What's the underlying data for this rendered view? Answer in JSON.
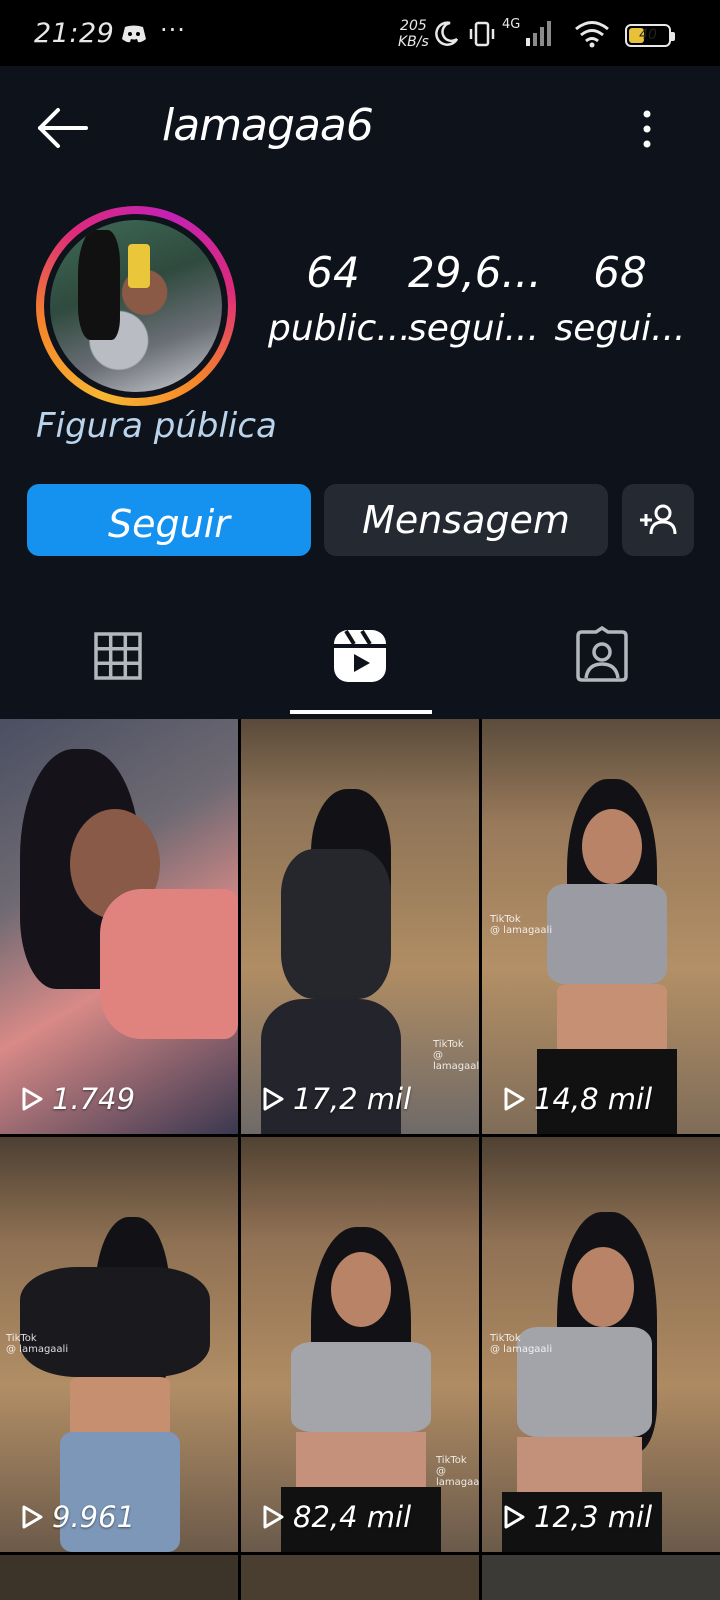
{
  "status_bar": {
    "time": "21:29",
    "overflow": "···",
    "net_speed_value": "205",
    "net_speed_unit": "KB/s",
    "network": "4G",
    "battery": "40",
    "icons": [
      "discord-icon",
      "moon-icon",
      "vibrate-icon",
      "signal-icon",
      "wifi-icon",
      "battery-icon"
    ]
  },
  "header": {
    "username": "lamagaa6",
    "back_icon": "arrow-left-icon",
    "menu_icon": "more-vertical-icon"
  },
  "profile": {
    "stats": [
      {
        "value": "64",
        "label": "public..."
      },
      {
        "value": "29,6...",
        "label": "segui..."
      },
      {
        "value": "68",
        "label": "segui..."
      }
    ],
    "category": "Figura pública"
  },
  "actions": {
    "follow": "Seguir",
    "message": "Mensagem",
    "add_user_icon": "person-add-icon"
  },
  "tabs": [
    {
      "icon": "grid-icon",
      "active": false
    },
    {
      "icon": "reels-icon",
      "active": true
    },
    {
      "icon": "tagged-icon",
      "active": false
    }
  ],
  "reels": [
    {
      "views": "1.749"
    },
    {
      "views": "17,2 mil",
      "watermark": "TikTok",
      "handle": "@ lamagaali"
    },
    {
      "views": "14,8 mil",
      "watermark": "TikTok",
      "handle": "@ lamagaali"
    },
    {
      "views": "9.961",
      "watermark": "TikTok",
      "handle": "@ lamagaali"
    },
    {
      "views": "82,4 mil",
      "watermark": "TikTok",
      "handle": "@ lamagaali"
    },
    {
      "views": "12,3 mil",
      "watermark": "TikTok",
      "handle": "@ lamagaali"
    }
  ],
  "colors": {
    "background": "#0e121a",
    "follow_button": "#1592f0",
    "secondary_button": "#252a32",
    "category_text": "#b9d4ec"
  }
}
